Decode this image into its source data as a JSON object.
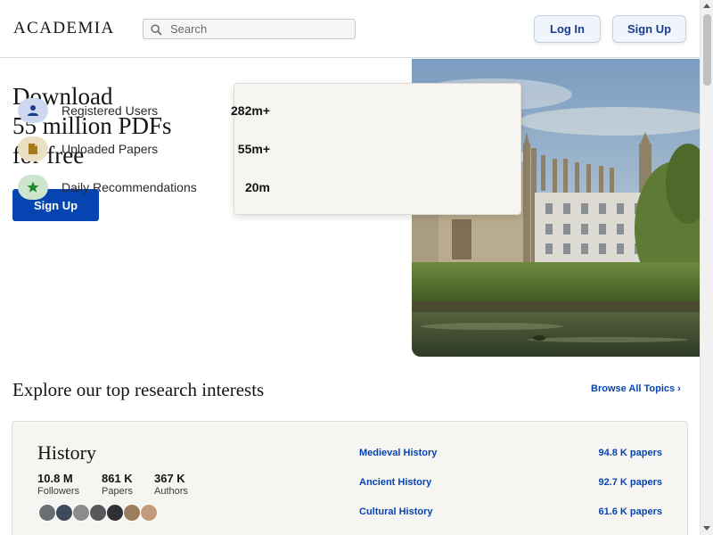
{
  "header": {
    "logo": "ACADEMIA",
    "search_placeholder": "Search",
    "login_label": "Log In",
    "signup_label": "Sign Up"
  },
  "hero": {
    "title_lines": [
      "Download",
      "55 million PDFs",
      "for free"
    ],
    "cta_label": "Sign Up",
    "photo_icon": "university-building-photo"
  },
  "stats": [
    {
      "label": "Registered Users",
      "value": "282m+",
      "icon": "user-icon",
      "color": "#cdd7ee"
    },
    {
      "label": "Uploaded Papers",
      "value": "55m+",
      "icon": "document-icon",
      "color": "#ebdfc1"
    },
    {
      "label": "Daily Recommendations",
      "value": "20m",
      "icon": "star-icon",
      "color": "#cde5cc"
    }
  ],
  "explore": {
    "title": "Explore our top research interests",
    "browse_label": "Browse All Topics ›"
  },
  "topic": {
    "name": "History",
    "metrics": [
      {
        "num": "10.8 M",
        "cap": "Followers"
      },
      {
        "num": "861 K",
        "cap": "Papers"
      },
      {
        "num": "367 K",
        "cap": "Authors"
      }
    ],
    "subtopics": [
      {
        "name": "Medieval History",
        "count": "94.8 K papers"
      },
      {
        "name": "Ancient History",
        "count": "92.7 K papers"
      },
      {
        "name": "Cultural History",
        "count": "61.6 K papers"
      }
    ]
  },
  "colors": {
    "brand_blue": "#0645b1",
    "card_bg": "#f6f5f1"
  }
}
